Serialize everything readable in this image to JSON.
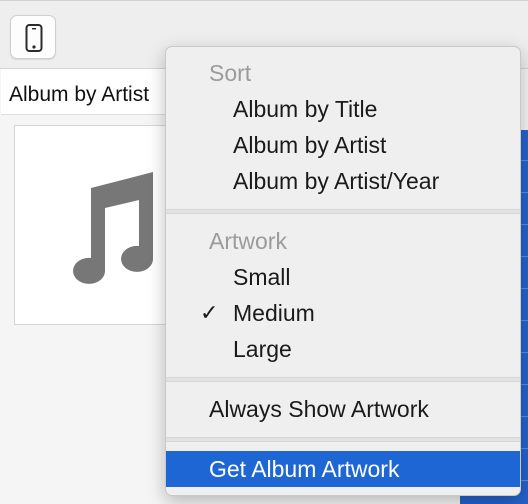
{
  "toolbar": {
    "device_button_icon": "iphone-icon"
  },
  "browser": {
    "column_header": "Album by Artist",
    "artwork_placeholder_icon": "music-note-icon"
  },
  "menu": {
    "sort_header": "Sort",
    "sort_items": [
      "Album by Title",
      "Album by Artist",
      "Album by Artist/Year"
    ],
    "artwork_header": "Artwork",
    "artwork_items": [
      "Small",
      "Medium",
      "Large"
    ],
    "artwork_checked": "Medium",
    "checkmark": "✓",
    "always_show_artwork": "Always Show Artwork",
    "get_album_artwork": "Get Album Artwork"
  },
  "colors": {
    "highlight": "#1e66d4",
    "selection_strip": "#2462cc",
    "header_gray": "#9b9b9b"
  }
}
